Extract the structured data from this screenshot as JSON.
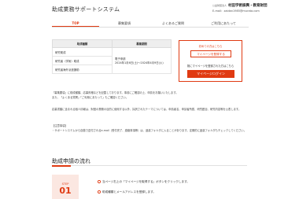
{
  "header": {
    "site_title": "助成業務サポートシステム",
    "org_label": "公益財団法人",
    "org_name": "村田学術振興・教育財団",
    "email_label": "E-mail：",
    "email_value": "zaidan1985@murata.com"
  },
  "nav": {
    "tabs": [
      {
        "label": "TOP",
        "active": true
      },
      {
        "label": "募集要項",
        "active": false
      },
      {
        "label": "よくあるご質問",
        "active": false
      },
      {
        "label": "ご利用にあたって",
        "active": false
      }
    ]
  },
  "table": {
    "headers": [
      "助成種類",
      "募集期間"
    ],
    "rows": [
      "研究助成",
      "研究者（学術）助成",
      "研究者海外派遣援助"
    ],
    "period_label": "電子申請",
    "period_value": "2024年1月6日(土)～2024年4月9日(火)"
  },
  "login_box": {
    "first_time": "初めての方はこちら",
    "register_button": "マイページを登録する",
    "registered": "既にマイページを登録された方はこちら",
    "login_button": "マイページログイン"
  },
  "body": {
    "p1": "『募集要項』に助成種類、応募資格などを記載しております。事前にご確認の上、申請をお願いいたします。",
    "p2": "また、「よくある質問」「ご利用にあたって」もご確認ください。",
    "p3": "応募書類に含まれる個人情報は、財団の業務の目的に使用する以外、採択されたテーマについては、申請者名、申請者所属、研究題目、研究内容等を公表します。",
    "notice_heading": "【注意事項】",
    "notice_text": "・サポートシステムから自動で送付されるe-mail（受付完了、連絡事項等）は、迷惑フォルダに入ることがあります。定期的に迷惑フォルダもチェックしてください。"
  },
  "flow": {
    "title": "助成申請の流れ",
    "step_label": "STEP",
    "step_num": "01",
    "items": [
      "当ページ右上の「マイページを取得する」ボタンをクリックします。",
      "助成種類とメールアドレスを登録します。"
    ]
  },
  "colors": {
    "accent": "#e03a12",
    "step_bg": "#fbe7e1"
  }
}
